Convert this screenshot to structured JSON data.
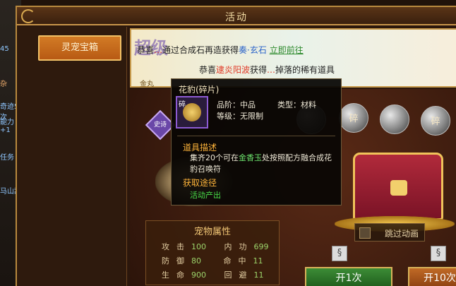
{
  "window": {
    "title": "活动"
  },
  "left_strip": {
    "lines": [
      "45",
      "杂",
      "奇迹5次",
      "能力+1",
      "任务",
      "马山舐"
    ]
  },
  "sidebar": {
    "tab_label": "灵宠宝箱"
  },
  "banner": {
    "big_text": "超级",
    "line1_prefix": "恭喜",
    "line1_name": "…",
    "line1_mid": "通过合成石再造获得",
    "line1_item": "奏·玄石",
    "line1_suffix": "立即前往",
    "line2_prefix": "恭喜",
    "line2_name": "逮炎阳波",
    "line2_mid": "获得",
    "line2_item": "…",
    "line2_suffix": "掉落的稀有道具",
    "corner_text": "金丸"
  },
  "main": {
    "rarity_label": "史诗",
    "balls": [
      {
        "label": ""
      },
      {
        "label": "碎"
      },
      {
        "label": ""
      },
      {
        "label": "碎"
      },
      {
        "label": ""
      }
    ]
  },
  "attributes": {
    "title": "宠物属性",
    "rows": [
      {
        "k1": "攻击",
        "v1": "100",
        "k2": "内功",
        "v2": "699"
      },
      {
        "k1": "防御",
        "v1": "80",
        "k2": "命中",
        "v2": "11"
      },
      {
        "k1": "生命",
        "v1": "900",
        "k2": "回避",
        "v2": "11"
      }
    ]
  },
  "skip": {
    "label": "跳过动画"
  },
  "buttons": {
    "once": "开1次",
    "ten": "开10次"
  },
  "tooltip": {
    "name": "花豹(碎片)",
    "icon_tag": "碎",
    "grade_label": "品阶：中品",
    "type_label": "类型：材料",
    "level_label": "等级：无限制",
    "desc_title": "道具描述",
    "desc_part1": "集齐20个可在",
    "desc_item": "金香玉",
    "desc_part2": "处按照配方融合成花豹召唤符",
    "source_title": "获取途径",
    "source_text": "活动产出"
  }
}
